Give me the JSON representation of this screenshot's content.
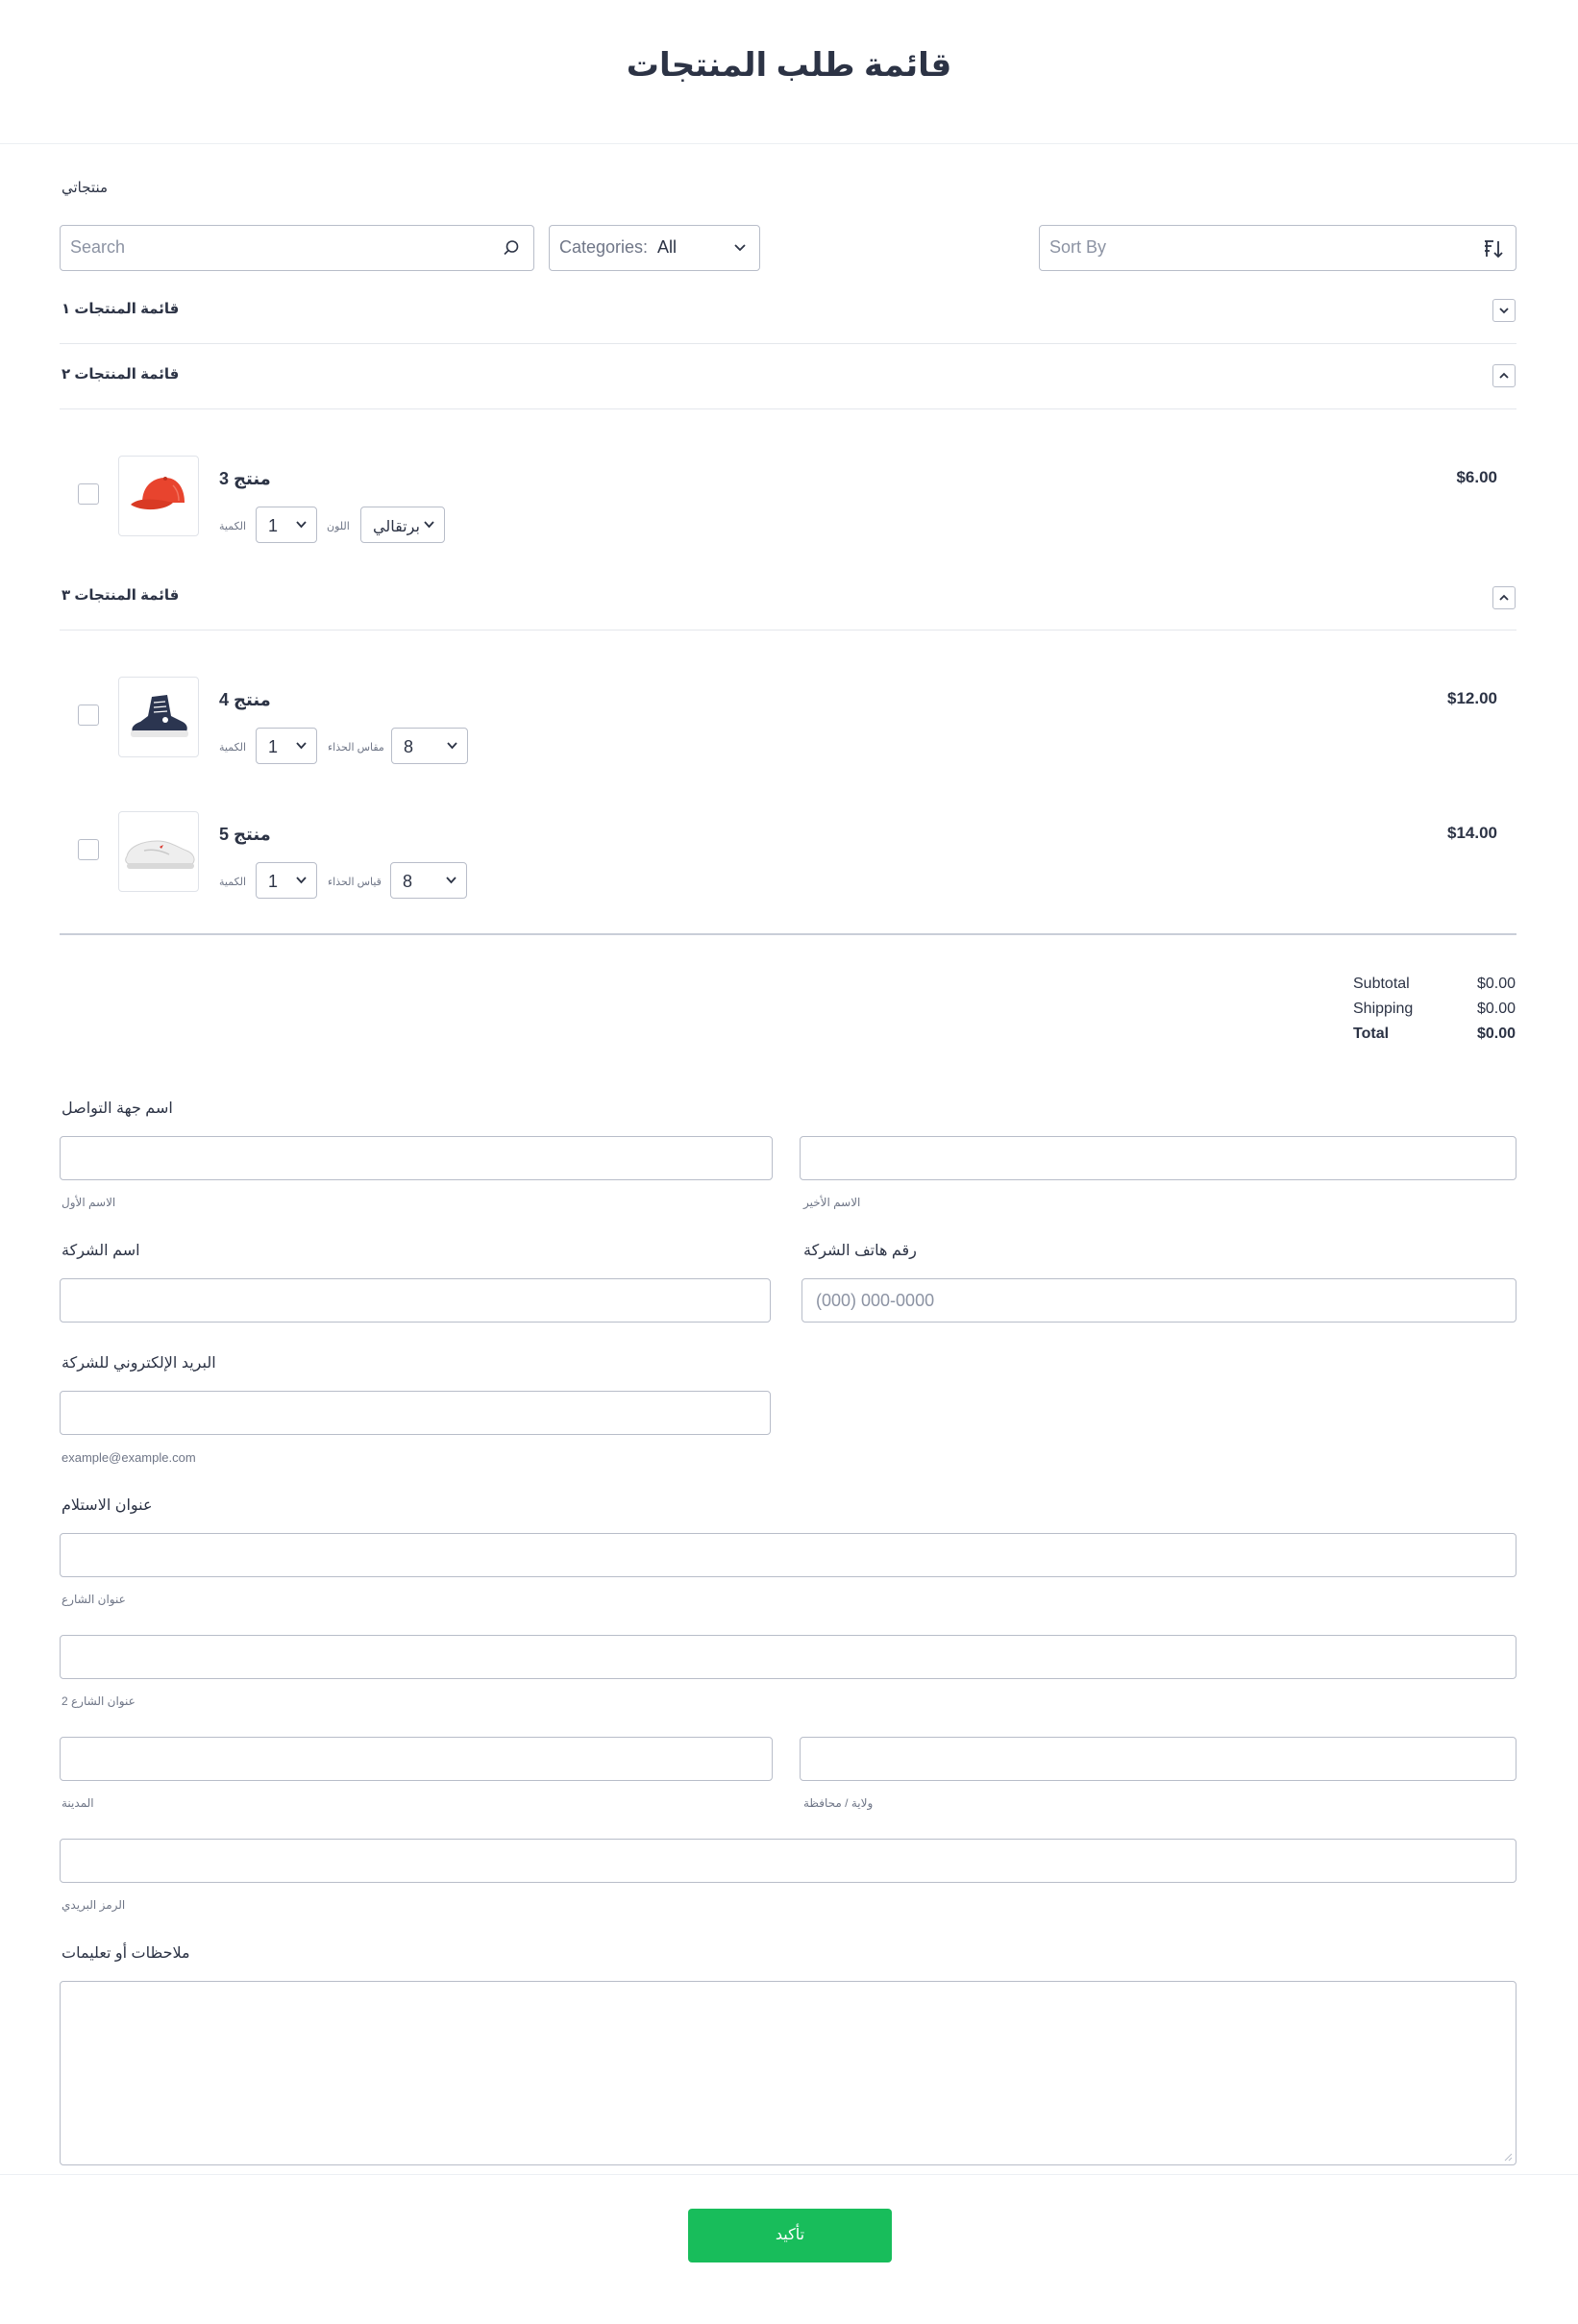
{
  "page": {
    "title": "قائمة طلب المنتجات"
  },
  "products_section": {
    "label": "منتجاتي",
    "search": {
      "placeholder": "Search"
    },
    "categories": {
      "prefix": "Categories: ",
      "value": "All"
    },
    "sort": {
      "placeholder": "Sort By"
    }
  },
  "categories": [
    {
      "title": "قائمة المنتجات ١",
      "expanded": false
    },
    {
      "title": "قائمة المنتجات ٢",
      "expanded": true
    },
    {
      "title": "قائمة المنتجات ٣",
      "expanded": true
    }
  ],
  "products": [
    {
      "name": "منتج 3",
      "price": "$6.00",
      "qty_label": "الكمية",
      "qty": "1",
      "opt_label": "اللون",
      "opt_value": "برتقالي",
      "image": "red-cap"
    },
    {
      "name": "منتج 4",
      "price": "$12.00",
      "qty_label": "الكمية",
      "qty": "1",
      "opt_label": "مقاس الحذاء",
      "opt_value": "8",
      "image": "navy-sneaker"
    },
    {
      "name": "منتج 5",
      "price": "$14.00",
      "qty_label": "الكمية",
      "qty": "1",
      "opt_label": "قياس الحذاء",
      "opt_value": "8",
      "image": "white-shoe"
    }
  ],
  "totals": {
    "subtotal_label": "Subtotal",
    "subtotal": "$0.00",
    "shipping_label": "Shipping",
    "shipping": "$0.00",
    "total_label": "Total",
    "total": "$0.00"
  },
  "form": {
    "contact_label": "اسم جهة التواصل",
    "first_name_sub": "الاسم الأول",
    "last_name_sub": "الاسم الأخير",
    "company_label": "اسم الشركة",
    "phone_label": "رقم هاتف الشركة",
    "phone_placeholder": "(000) 000-0000",
    "email_label": "البريد الإلكتروني للشركة",
    "email_sub": "example@example.com",
    "address_label": "عنوان الاستلام",
    "street_sub": "عنوان الشارع",
    "street2_sub": "عنوان الشارع 2",
    "city_sub": "المدينة",
    "state_sub": "ولاية / محافظة",
    "zip_sub": "الرمز البريدي",
    "notes_label": "ملاحظات أو تعليمات",
    "submit_label": "تأكيد"
  },
  "colors": {
    "accent": "#18bd5b",
    "text": "#2c3345",
    "border": "#b8bdc9"
  }
}
